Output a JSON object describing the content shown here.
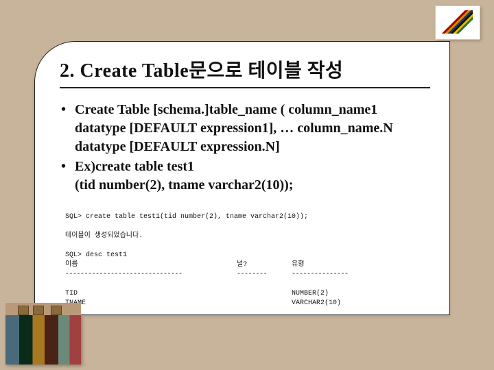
{
  "title": "2. Create Table문으로 테이블 작성",
  "bullets": [
    "Create Table [schema.]table_name ( column_name1 datatype [DEFAULT expression1], … column_name.N datatype [DEFAULT expression.N]",
    "Ex)create table test1\n(tid number(2), tname varchar2(10));"
  ],
  "terminal": {
    "cmd_create": "SQL> create table test1(tid number(2), tname varchar2(10));",
    "msg_created": "테이블이 생성되었습니다.",
    "cmd_desc": "SQL> desc test1",
    "header_name": "이름",
    "header_null": "널?",
    "header_type": "유형",
    "dash_name": "-------------------------------",
    "dash_null": "--------",
    "dash_type": "---------------",
    "rows": [
      {
        "name": "TID",
        "null": "",
        "type": "NUMBER(2)"
      },
      {
        "name": "TNAME",
        "null": "",
        "type": "VARCHAR2(10)"
      }
    ]
  }
}
